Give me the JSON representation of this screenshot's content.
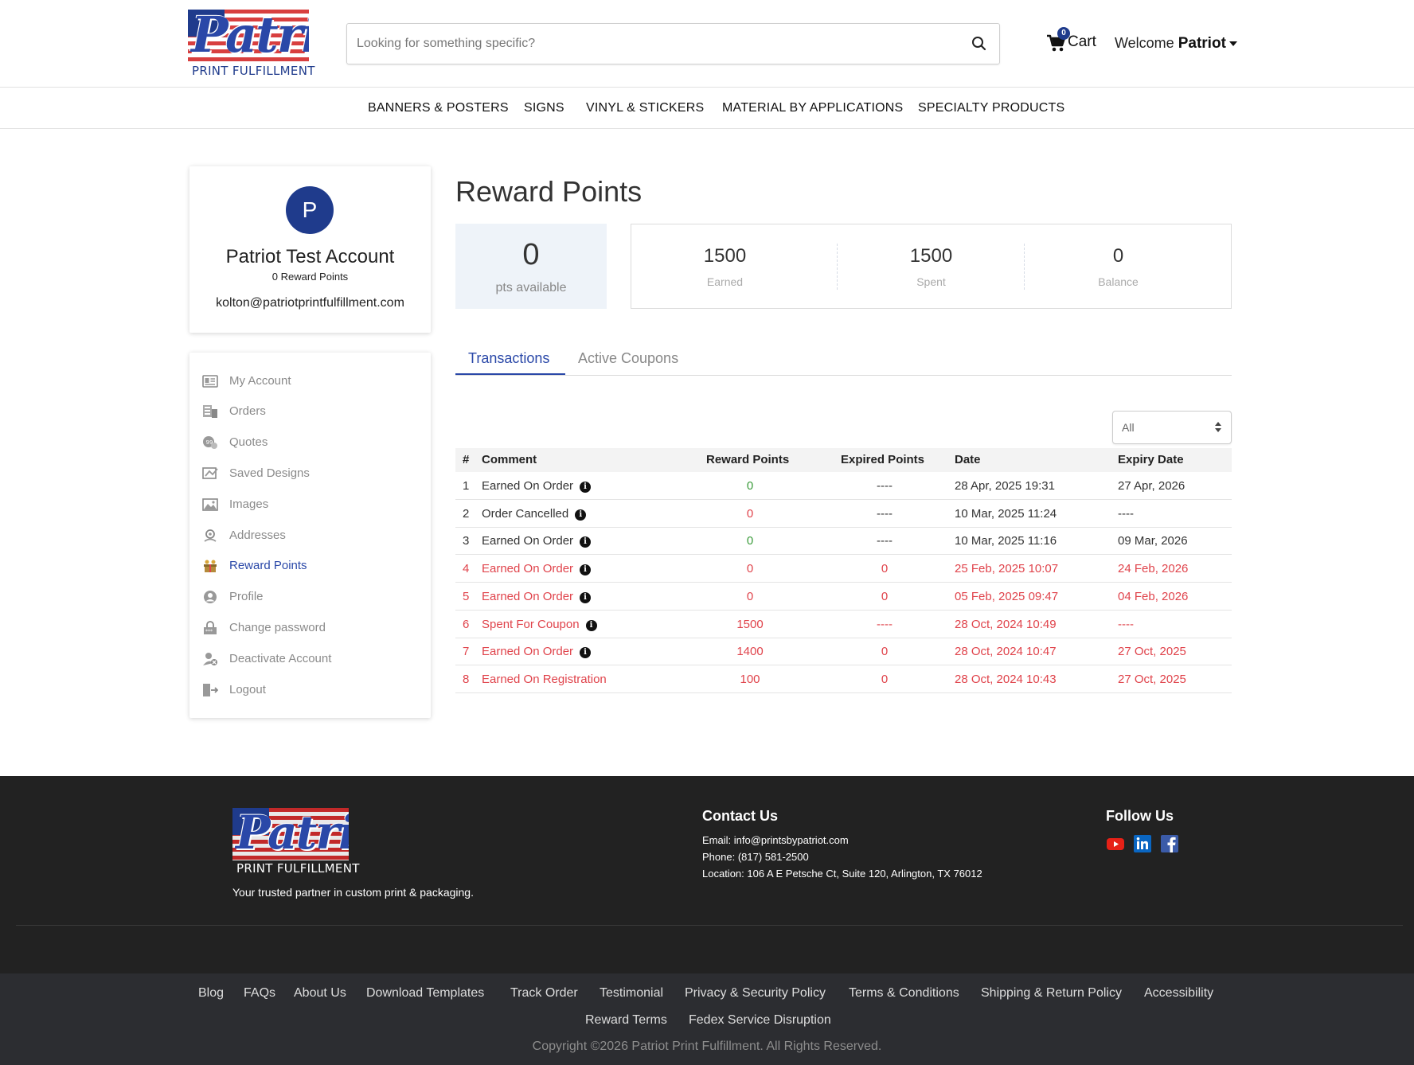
{
  "header": {
    "logo": {
      "word": "Patriot",
      "sub": "PRINT FULFILLMENT"
    },
    "search": {
      "placeholder": "Looking for something specific?",
      "value": ""
    },
    "cart": {
      "label": "Cart",
      "count": "0"
    },
    "welcome": {
      "prefix": "Welcome",
      "name": "Patriot"
    }
  },
  "nav": {
    "items": [
      "BANNERS & POSTERS",
      "SIGNS",
      "VINYL & STICKERS",
      "MATERIAL BY APPLICATIONS",
      "SPECIALTY PRODUCTS"
    ]
  },
  "profile": {
    "initial": "P",
    "name": "Patriot Test Account",
    "points": "0 Reward Points",
    "email": "kolton@patriotprintfulfillment.com"
  },
  "sidebar": {
    "items": [
      {
        "label": "My Account",
        "icon": "id-card-icon"
      },
      {
        "label": "Orders",
        "icon": "orders-icon"
      },
      {
        "label": "Quotes",
        "icon": "quotes-icon"
      },
      {
        "label": "Saved Designs",
        "icon": "saved-designs-icon"
      },
      {
        "label": "Images",
        "icon": "images-icon"
      },
      {
        "label": "Addresses",
        "icon": "address-pin-icon"
      },
      {
        "label": "Reward Points",
        "icon": "reward-icon",
        "active": true
      },
      {
        "label": "Profile",
        "icon": "profile-icon"
      },
      {
        "label": "Change password",
        "icon": "password-icon"
      },
      {
        "label": "Deactivate Account",
        "icon": "deactivate-user-icon"
      },
      {
        "label": "Logout",
        "icon": "logout-icon"
      }
    ]
  },
  "main": {
    "title": "Reward Points",
    "available": {
      "value": "0",
      "label": "pts available"
    },
    "summary": [
      {
        "value": "1500",
        "label": "Earned"
      },
      {
        "value": "1500",
        "label": "Spent"
      },
      {
        "value": "0",
        "label": "Balance"
      }
    ],
    "tabs": [
      {
        "label": "Transactions",
        "active": true
      },
      {
        "label": "Active Coupons",
        "active": false
      }
    ],
    "filter": {
      "value": "All"
    },
    "table": {
      "headers": [
        "#",
        "Comment",
        "Reward Points",
        "Expired Points",
        "Date",
        "Expiry Date"
      ],
      "rows": [
        {
          "num": "1",
          "comment": "Earned On Order",
          "info": true,
          "points": "0",
          "expired": "----",
          "date": "28 Apr, 2025 19:31",
          "expiry": "27 Apr, 2026",
          "style": "normal",
          "pointsColor": "green"
        },
        {
          "num": "2",
          "comment": "Order Cancelled",
          "info": true,
          "points": "0",
          "expired": "----",
          "date": "10 Mar, 2025 11:24",
          "expiry": "----",
          "style": "normal",
          "pointsColor": "red"
        },
        {
          "num": "3",
          "comment": "Earned On Order",
          "info": true,
          "points": "0",
          "expired": "----",
          "date": "10 Mar, 2025 11:16",
          "expiry": "09 Mar, 2026",
          "style": "normal",
          "pointsColor": "green"
        },
        {
          "num": "4",
          "comment": "Earned On Order",
          "info": true,
          "points": "0",
          "expired": "0",
          "date": "25 Feb, 2025 10:07",
          "expiry": "24 Feb, 2026",
          "style": "red",
          "pointsColor": "red"
        },
        {
          "num": "5",
          "comment": "Earned On Order",
          "info": true,
          "points": "0",
          "expired": "0",
          "date": "05 Feb, 2025 09:47",
          "expiry": "04 Feb, 2026",
          "style": "red",
          "pointsColor": "red"
        },
        {
          "num": "6",
          "comment": "Spent For Coupon",
          "info": true,
          "points": "1500",
          "expired": "----",
          "date": "28 Oct, 2024 10:49",
          "expiry": "----",
          "style": "red",
          "pointsColor": "red"
        },
        {
          "num": "7",
          "comment": "Earned On Order",
          "info": true,
          "points": "1400",
          "expired": "0",
          "date": "28 Oct, 2024 10:47",
          "expiry": "27 Oct, 2025",
          "style": "red",
          "pointsColor": "red"
        },
        {
          "num": "8",
          "comment": "Earned On Registration",
          "info": false,
          "points": "100",
          "expired": "0",
          "date": "28 Oct, 2024 10:43",
          "expiry": "27 Oct, 2025",
          "style": "red",
          "pointsColor": "red"
        }
      ]
    }
  },
  "footer": {
    "logo": {
      "word": "Patriot",
      "sub": "PRINT FULFILLMENT"
    },
    "tagline": "Your trusted partner in custom print & packaging.",
    "contact": {
      "title": "Contact Us",
      "email": "Email: info@printsbypatriot.com",
      "phone": "Phone: (817) 581-2500",
      "location": "Location: 106 A E Petsche Ct, Suite 120, Arlington, TX 76012"
    },
    "follow": {
      "title": "Follow Us",
      "icons": [
        "youtube-icon",
        "linkedin-icon",
        "facebook-icon"
      ]
    },
    "links_row1": [
      "Blog",
      "FAQs",
      "About Us",
      "Download Templates",
      "Track Order",
      "Testimonial",
      "Privacy & Security Policy",
      "Terms & Conditions",
      "Shipping & Return Policy",
      "Accessibility"
    ],
    "links_row2": [
      "Reward Terms",
      "Fedex Service Disruption"
    ],
    "copyright": "Copyright ©2026 Patriot Print Fulfillment. All Rights Reserved."
  },
  "colors": {
    "brand_blue": "#2a48a8",
    "avatar_blue": "#1f3b8c",
    "red_row": "#e0434b",
    "green_points": "#3a9b3a",
    "footer_bg": "#222222",
    "footer_bottom_bg": "#2c2d31"
  }
}
